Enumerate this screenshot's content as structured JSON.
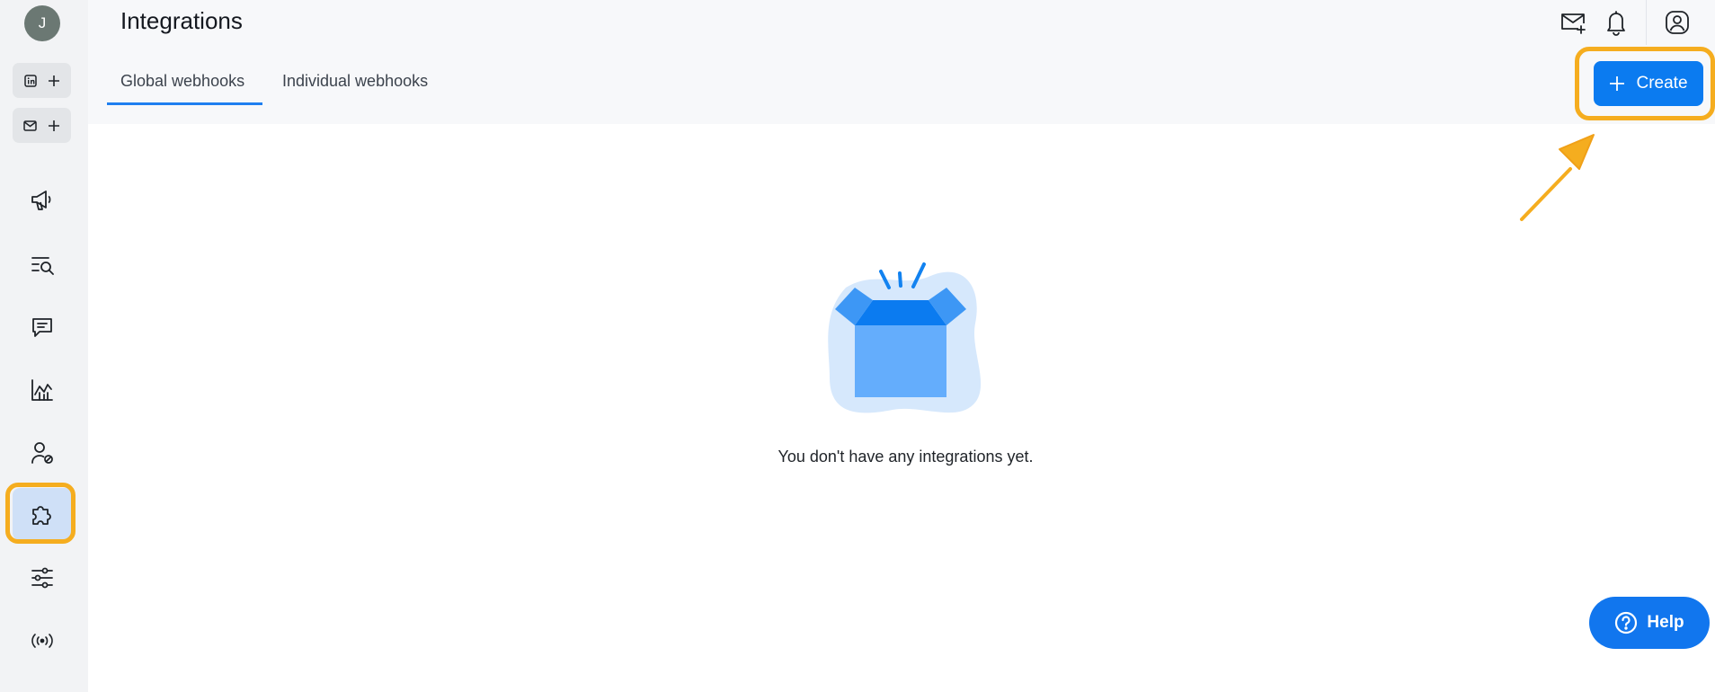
{
  "app": {
    "title": "Integrations"
  },
  "user": {
    "initial": "J"
  },
  "sidebar": {
    "account_buttons": [
      {
        "icon": "linkedin-icon",
        "action_icon": "plus-icon"
      },
      {
        "icon": "mail-icon",
        "action_icon": "plus-icon"
      }
    ],
    "items": [
      {
        "name": "campaigns",
        "icon": "megaphone-icon"
      },
      {
        "name": "search",
        "icon": "list-search-icon"
      },
      {
        "name": "messages",
        "icon": "chat-icon"
      },
      {
        "name": "analytics",
        "icon": "chart-icon"
      },
      {
        "name": "contacts",
        "icon": "user-blocked-icon"
      },
      {
        "name": "integrations",
        "icon": "puzzle-icon",
        "active": true
      },
      {
        "name": "settings",
        "icon": "sliders-icon"
      },
      {
        "name": "broadcast",
        "icon": "signal-icon"
      }
    ]
  },
  "header": {
    "icons": [
      "mail-plus-icon",
      "bell-icon",
      "profile-icon"
    ],
    "tabs": [
      {
        "label": "Global webhooks",
        "active": true
      },
      {
        "label": "Individual webhooks",
        "active": false
      }
    ],
    "create_label": "Create"
  },
  "empty_state": {
    "message": "You don't have any integrations yet.",
    "icon": "open-box-icon"
  },
  "help": {
    "label": "Help",
    "icon": "question-icon"
  },
  "colors": {
    "accent": "#0b7bf0",
    "highlight": "#f5ad1f",
    "active_nav": "#cfe0f7"
  }
}
